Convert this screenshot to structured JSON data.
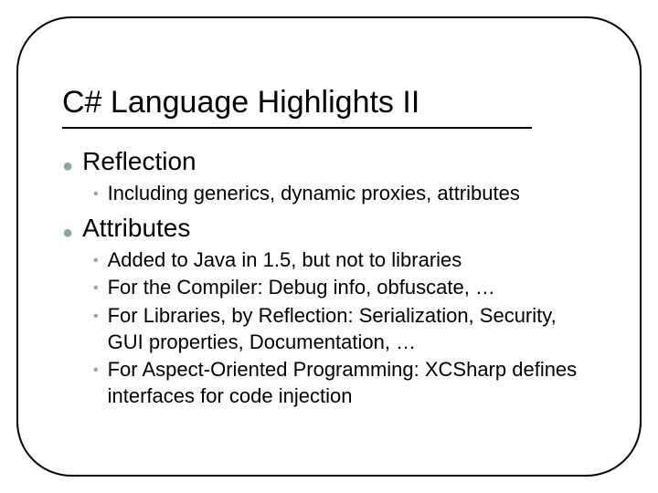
{
  "title": "C# Language Highlights II",
  "bullets": [
    {
      "label": "Reflection",
      "sub": [
        "Including generics, dynamic proxies, attributes"
      ]
    },
    {
      "label": "Attributes",
      "sub": [
        "Added to Java in 1.5, but not to libraries",
        "For the Compiler: Debug info, obfuscate, …",
        "For Libraries, by Reflection: Serialization, Security, GUI properties, Documentation, …",
        "For Aspect-Oriented Programming: XCSharp defines interfaces for code injection"
      ]
    }
  ]
}
